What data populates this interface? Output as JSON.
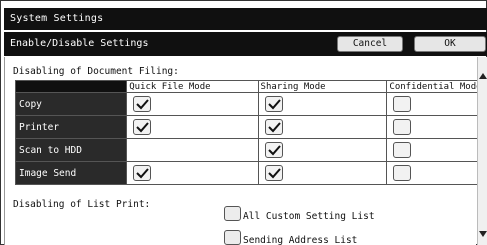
{
  "window": {
    "title": "System Settings"
  },
  "header": {
    "title": "Enable/Disable Settings",
    "cancel_label": "Cancel",
    "ok_label": "OK"
  },
  "doc_filing": {
    "label": "Disabling of Document Filing:",
    "columns": [
      "Quick File Mode",
      "Sharing Mode",
      "Confidential Mode"
    ],
    "rows": [
      {
        "name": "Copy",
        "checks": [
          true,
          true,
          false
        ]
      },
      {
        "name": "Printer",
        "checks": [
          true,
          true,
          false
        ]
      },
      {
        "name": "Scan to HDD",
        "checks": [
          null,
          true,
          false
        ]
      },
      {
        "name": "Image Send",
        "checks": [
          true,
          true,
          false
        ]
      }
    ]
  },
  "list_print": {
    "label": "Disabling of List Print:",
    "options": [
      {
        "label": "All Custom Setting List",
        "checked": false
      },
      {
        "label": "Sending Address List",
        "checked": false
      }
    ]
  },
  "icons": {
    "check": "checkmark-icon",
    "scroll_up": "arrow-up-icon",
    "scroll_down": "arrow-down-icon"
  }
}
